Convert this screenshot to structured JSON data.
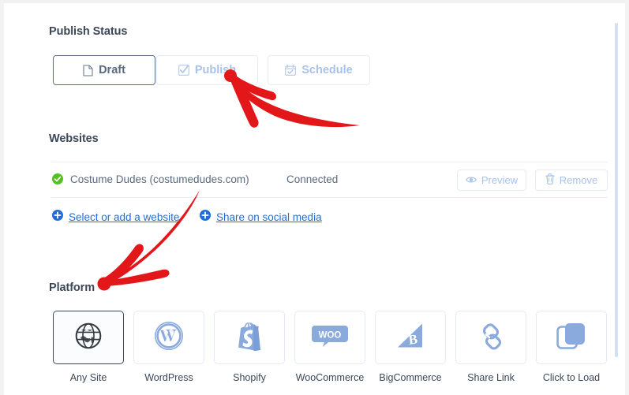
{
  "publish_status": {
    "title": "Publish Status",
    "options": [
      {
        "label": "Draft",
        "icon": "document-icon",
        "state": "active"
      },
      {
        "label": "Publish",
        "icon": "checkbox-icon",
        "state": "inactive"
      },
      {
        "label": "Schedule",
        "icon": "calendar-check-icon",
        "state": "inactive"
      }
    ]
  },
  "websites": {
    "title": "Websites",
    "row": {
      "status_icon": "green-check-icon",
      "name": "Costume Dudes (costumedudes.com)",
      "status": "Connected",
      "preview_label": "Preview",
      "preview_icon": "eye-icon",
      "remove_label": "Remove",
      "remove_icon": "trash-icon"
    },
    "links": [
      {
        "label": "Select or add a website",
        "icon": "plus-circle-icon"
      },
      {
        "label": "Share on social media",
        "icon": "plus-circle-icon"
      }
    ]
  },
  "platform": {
    "title": "Platform",
    "tiles": [
      {
        "label": "Any Site",
        "icon": "globe-icon",
        "selected": true
      },
      {
        "label": "WordPress",
        "icon": "wordpress-icon",
        "selected": false
      },
      {
        "label": "Shopify",
        "icon": "shopify-bag-icon",
        "selected": false
      },
      {
        "label": "WooCommerce",
        "icon": "woocommerce-icon",
        "selected": false
      },
      {
        "label": "BigCommerce",
        "icon": "bigcommerce-icon",
        "selected": false
      },
      {
        "label": "Share Link",
        "icon": "chain-link-icon",
        "selected": false
      },
      {
        "label": "Click to Load",
        "icon": "stacked-squares-icon",
        "selected": false
      }
    ]
  },
  "annotations": {
    "arrow_color": "#e3161a",
    "arrows": [
      {
        "name": "arrow-to-publish-button",
        "points_to": "Publish"
      },
      {
        "name": "arrow-to-platform-heading",
        "points_to": "Platform"
      }
    ]
  },
  "colors": {
    "heading": "#3c4858",
    "muted_blue": "#a9c2e8",
    "link": "#1f6ddb",
    "green": "#54c122",
    "icon_blue": "#8aaade"
  }
}
